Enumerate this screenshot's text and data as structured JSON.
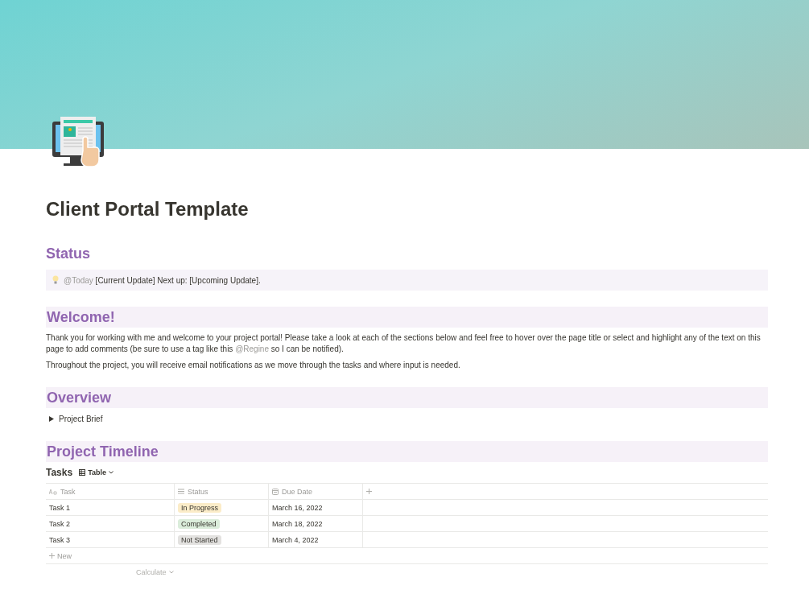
{
  "page": {
    "title": "Client Portal Template"
  },
  "status": {
    "heading": "Status",
    "callout": {
      "mention": "@Today",
      "text": " [Current Update] Next up: [Upcoming Update]."
    }
  },
  "welcome": {
    "heading": "Welcome!",
    "paragraphs": [
      {
        "before": "Thank you for working with me and welcome to your project portal! Please take a look at each of the sections below and feel free to hover over the page title or select and highlight any of the text on this page to add comments (be sure to use a tag like this ",
        "mention": "@Regine",
        "after": " so I can be notified)."
      },
      {
        "before": "Throughout the project, you will receive email notifications as we move through the tasks and where input is needed."
      }
    ]
  },
  "overview": {
    "heading": "Overview",
    "toggles": [
      {
        "label": "Project Brief",
        "expanded": false
      }
    ]
  },
  "timeline": {
    "heading": "Project Timeline",
    "database": {
      "title": "Tasks",
      "view": "Table"
    },
    "table": {
      "columns": [
        {
          "label": "Task",
          "kind": "title"
        },
        {
          "label": "Status",
          "kind": "select"
        },
        {
          "label": "Due Date",
          "kind": "date"
        }
      ],
      "rows": [
        {
          "task": "Task 1",
          "status": {
            "label": "In Progress",
            "color": "#fbecc8"
          },
          "due": "March 16, 2022"
        },
        {
          "task": "Task 2",
          "status": {
            "label": "Completed",
            "color": "#dbeddb"
          },
          "due": "March 18, 2022"
        },
        {
          "task": "Task 3",
          "status": {
            "label": "Not Started",
            "color": "#e3e2e0"
          },
          "due": "March 4, 2022"
        }
      ],
      "new_label": "New",
      "calculate_label": "Calculate"
    }
  }
}
